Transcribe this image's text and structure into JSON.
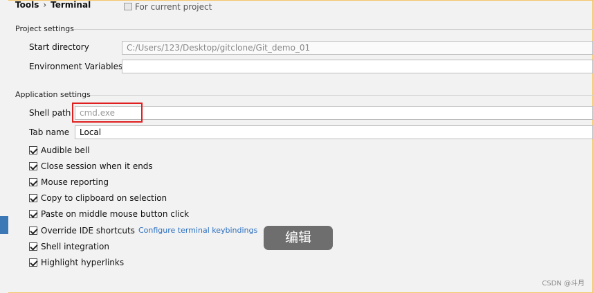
{
  "breadcrumb": {
    "parent": "Tools",
    "separator": "›",
    "current": "Terminal"
  },
  "scope_note": "For current project",
  "project_settings": {
    "title": "Project settings",
    "start_directory_label": "Start directory",
    "start_directory_value": "C:/Users/123/Desktop/gitclone/Git_demo_01",
    "env_vars_label": "Environment Variables",
    "env_vars_value": ""
  },
  "application_settings": {
    "title": "Application settings",
    "shell_path_label": "Shell path",
    "shell_path_placeholder": "cmd.exe",
    "tab_name_label": "Tab name",
    "tab_name_value": "Local",
    "options": [
      {
        "label": "Audible bell",
        "checked": true
      },
      {
        "label": "Close session when it ends",
        "checked": true
      },
      {
        "label": "Mouse reporting",
        "checked": true
      },
      {
        "label": "Copy to clipboard on selection",
        "checked": true
      },
      {
        "label": "Paste on middle mouse button click",
        "checked": true
      },
      {
        "label": "Override IDE shortcuts",
        "checked": true
      },
      {
        "label": "Shell integration",
        "checked": true
      },
      {
        "label": "Highlight hyperlinks",
        "checked": true
      }
    ],
    "keybindings_link": "Configure terminal keybindings"
  },
  "toast": "编辑",
  "watermark": "CSDN @斗月",
  "colors": {
    "accent": "#3c78b5",
    "highlight": "#e02020",
    "link": "#2a6ebf"
  }
}
